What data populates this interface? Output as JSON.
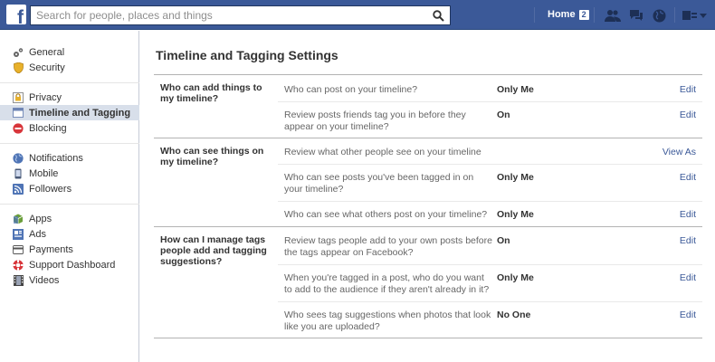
{
  "topbar": {
    "logo_letter": "f",
    "search_placeholder": "Search for people, places and things",
    "home_label": "Home",
    "home_count": "2",
    "icons": [
      "friend-requests-icon",
      "messages-icon",
      "notifications-globe-icon",
      "account-settings-icon",
      "dropdown-arrow-icon"
    ],
    "brand_color": "#3b5998"
  },
  "sidebar": {
    "groups": [
      [
        {
          "label": "General",
          "icon": "gears-icon"
        },
        {
          "label": "Security",
          "icon": "shield-icon"
        }
      ],
      [
        {
          "label": "Privacy",
          "icon": "lock-icon"
        },
        {
          "label": "Timeline and Tagging",
          "icon": "timeline-icon",
          "active": true
        },
        {
          "label": "Blocking",
          "icon": "blocking-icon"
        }
      ],
      [
        {
          "label": "Notifications",
          "icon": "globe-icon"
        },
        {
          "label": "Mobile",
          "icon": "mobile-icon"
        },
        {
          "label": "Followers",
          "icon": "rss-icon"
        }
      ],
      [
        {
          "label": "Apps",
          "icon": "apps-cube-icon"
        },
        {
          "label": "Ads",
          "icon": "ads-icon"
        },
        {
          "label": "Payments",
          "icon": "payments-card-icon"
        },
        {
          "label": "Support Dashboard",
          "icon": "lifebuoy-icon"
        },
        {
          "label": "Videos",
          "icon": "film-icon"
        }
      ]
    ]
  },
  "main": {
    "title": "Timeline and Tagging Settings",
    "sections": [
      {
        "label": "Who can add things to my timeline?",
        "rows": [
          {
            "question": "Who can post on your timeline?",
            "value": "Only Me",
            "action": "Edit"
          },
          {
            "question": "Review posts friends tag you in before they appear on your timeline?",
            "value": "On",
            "action": "Edit"
          }
        ]
      },
      {
        "label": "Who can see things on my timeline?",
        "rows": [
          {
            "question": "Review what other people see on your timeline",
            "value": "",
            "action": "View As"
          },
          {
            "question": "Who can see posts you've been tagged in on your timeline?",
            "value": "Only Me",
            "action": "Edit"
          },
          {
            "question": "Who can see what others post on your timeline?",
            "value": "Only Me",
            "action": "Edit"
          }
        ]
      },
      {
        "label": "How can I manage tags people add and tagging suggestions?",
        "rows": [
          {
            "question": "Review tags people add to your own posts before the tags appear on Facebook?",
            "value": "On",
            "action": "Edit"
          },
          {
            "question": "When you're tagged in a post, who do you want to add to the audience if they aren't already in it?",
            "value": "Only Me",
            "action": "Edit"
          },
          {
            "question": "Who sees tag suggestions when photos that look like you are uploaded?",
            "value": "No One",
            "action": "Edit"
          }
        ]
      }
    ]
  }
}
